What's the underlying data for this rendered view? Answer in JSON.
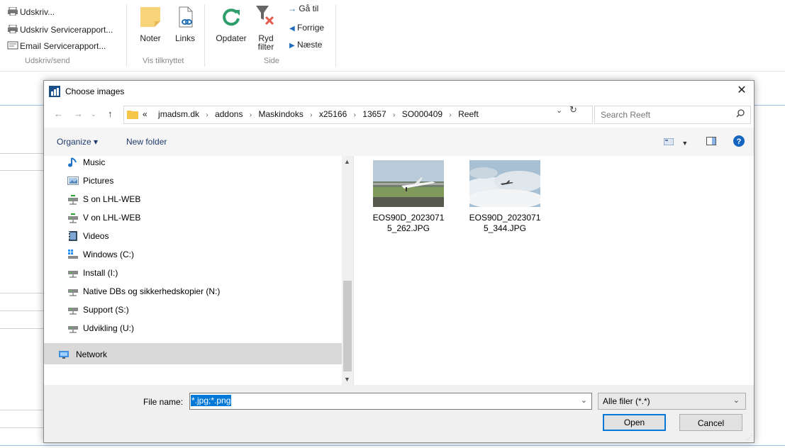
{
  "ribbon": {
    "print_group": {
      "items": [
        "Udskriv...",
        "Udskriv Servicerapport...",
        "Email Servicerapport..."
      ],
      "label": "Udskriv/send"
    },
    "attached_group": {
      "notes": "Noter",
      "links": "Links",
      "label": "Vis tilknyttet"
    },
    "page_group": {
      "refresh": "Opdater",
      "clear_filter_1": "Ryd",
      "clear_filter_2": "filter",
      "goto": "Gå til",
      "previous": "Forrige",
      "next": "Næste",
      "label": "Side"
    }
  },
  "dialog": {
    "title": "Choose images",
    "breadcrumb": [
      "«",
      "jmadsm.dk",
      "addons",
      "Maskindoks",
      "x25166",
      "13657",
      "SO000409",
      "Reeft"
    ],
    "search_placeholder": "Search Reeft",
    "toolbar": {
      "organize": "Organize ▾",
      "new_folder": "New folder"
    },
    "tree": [
      {
        "label": "Music",
        "icon": "music-icon"
      },
      {
        "label": "Pictures",
        "icon": "pictures-icon"
      },
      {
        "label": "S on LHL-WEB",
        "icon": "network-drive-icon"
      },
      {
        "label": "V on LHL-WEB",
        "icon": "network-drive-icon"
      },
      {
        "label": "Videos",
        "icon": "videos-icon"
      },
      {
        "label": "Windows (C:)",
        "icon": "windows-drive-icon"
      },
      {
        "label": "Install (I:)",
        "icon": "drive-icon"
      },
      {
        "label": "Native DBs og sikkerhedskopier (N:)",
        "icon": "drive-icon"
      },
      {
        "label": "Support (S:)",
        "icon": "drive-icon"
      },
      {
        "label": "Udvikling (U:)",
        "icon": "drive-icon"
      },
      {
        "label": "Network",
        "icon": "network-icon",
        "selected": true
      }
    ],
    "files": [
      {
        "name": "EOS90D_20230715_262.JPG"
      },
      {
        "name": "EOS90D_20230715_344.JPG"
      }
    ],
    "file_name_label": "File name:",
    "file_name_value": "*.jpg;*.png",
    "file_type": "Alle filer (*.*)",
    "open_button": "Open",
    "cancel_button": "Cancel"
  },
  "colors": {
    "accent": "#0078d7",
    "selection": "#d9d9d9"
  }
}
